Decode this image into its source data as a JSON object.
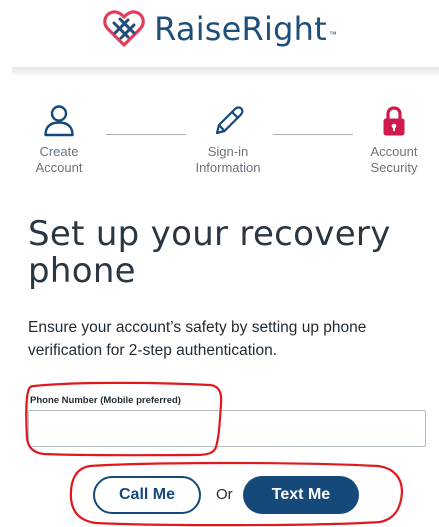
{
  "brand": {
    "name": "RaiseRight",
    "trademark": "™",
    "color": "#1e4f7a",
    "logo_icon": "heart-knot-logo",
    "logo_colors": [
      "#e23b5d",
      "#1e4f7a"
    ]
  },
  "stepper": {
    "steps": [
      {
        "line1": "Create",
        "line2": "Account",
        "icon": "person-icon",
        "state": "complete"
      },
      {
        "line1": "Sign-in",
        "line2": "Information",
        "icon": "pencil-icon",
        "state": "complete"
      },
      {
        "line1": "Account",
        "line2": "Security",
        "icon": "lock-icon",
        "state": "active"
      }
    ],
    "active_color": "#d1194e"
  },
  "main": {
    "title": "Set up your recovery phone",
    "description": "Ensure your account’s safety by setting up phone verification for 2-step authentication.",
    "phone_field": {
      "label": "Phone Number (Mobile preferred)",
      "value": "",
      "placeholder": ""
    },
    "call_label": "Call Me",
    "or_label": "Or",
    "text_label": "Text Me",
    "primary_color": "#15497a"
  },
  "annotations": {
    "color": "#e0191f"
  }
}
